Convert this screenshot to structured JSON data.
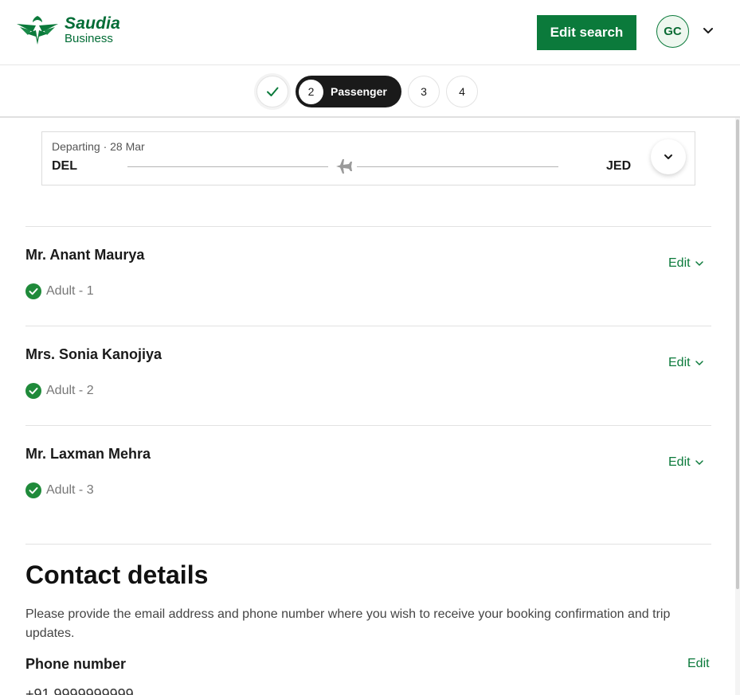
{
  "header": {
    "brand": "Saudia",
    "brand_sub": "Business",
    "edit_search_label": "Edit search",
    "avatar_initials": "GC"
  },
  "stepper": {
    "active_number": "2",
    "active_label": "Passenger",
    "step3": "3",
    "step4": "4"
  },
  "flight": {
    "departing_label": "Departing · 28 Mar",
    "from": "DEL",
    "to": "JED"
  },
  "passengers": [
    {
      "name": "Mr. Anant Maurya",
      "type": "Adult - 1",
      "edit_label": "Edit"
    },
    {
      "name": "Mrs. Sonia Kanojiya",
      "type": "Adult - 2",
      "edit_label": "Edit"
    },
    {
      "name": "Mr. Laxman Mehra",
      "type": "Adult - 3",
      "edit_label": "Edit"
    }
  ],
  "contact": {
    "title": "Contact details",
    "description": "Please provide the email address and phone number where you wish to receive your booking confirmation and trip updates.",
    "phone_label": "Phone number",
    "phone_edit_label": "Edit",
    "phone_value": "+91 9999999999"
  },
  "colors": {
    "brand_green": "#0b7a3b",
    "check_green": "#1f8a3a",
    "dark": "#1a1a1a"
  }
}
